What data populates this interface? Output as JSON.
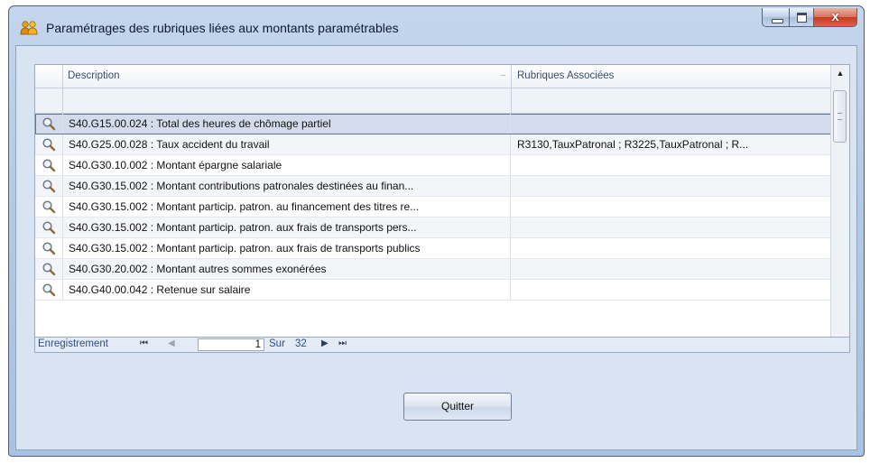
{
  "window": {
    "title": "Paramétrages des rubriques liées aux montants paramétrables",
    "close_glyph": "x"
  },
  "grid": {
    "columns": [
      "Description",
      "Rubriques Associées"
    ],
    "rows": [
      {
        "description": "S40.G15.00.024 : Total des heures de chômage partiel",
        "rubriques": "",
        "selected": true
      },
      {
        "description": "S40.G25.00.028 : Taux accident du travail",
        "rubriques": "R3130,TauxPatronal ; R3225,TauxPatronal ; R..."
      },
      {
        "description": "S40.G30.10.002 : Montant épargne salariale",
        "rubriques": ""
      },
      {
        "description": "S40.G30.15.002 : Montant contributions patronales destinées au finan...",
        "rubriques": ""
      },
      {
        "description": "S40.G30.15.002 : Montant particip. patron. au financement des titres re...",
        "rubriques": ""
      },
      {
        "description": "S40.G30.15.002 : Montant particip. patron. aux frais de transports pers...",
        "rubriques": ""
      },
      {
        "description": "S40.G30.15.002 : Montant particip. patron. aux frais de transports publics",
        "rubriques": ""
      },
      {
        "description": "S40.G30.20.002 : Montant autres sommes exonérées",
        "rubriques": ""
      },
      {
        "description": "S40.G40.00.042 : Retenue sur salaire",
        "rubriques": ""
      }
    ]
  },
  "navigator": {
    "label": "Enregistrement",
    "first": "⏮",
    "prev": "◀",
    "position": "1",
    "of_label": "Sur",
    "count": "32",
    "next": "▶",
    "last": "⏭"
  },
  "buttons": {
    "quit": "Quitter"
  },
  "colors": {
    "window_bg": "#c4d6ec",
    "client_bg": "#d9e4f2",
    "selected_row": "#d4dceb",
    "nav_text": "#2d4e86"
  }
}
